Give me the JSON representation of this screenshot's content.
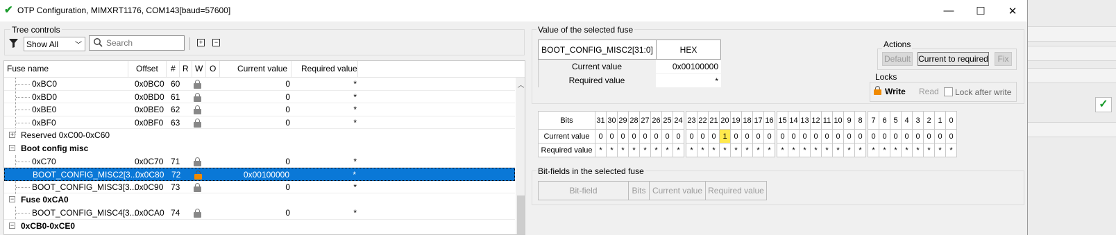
{
  "window": {
    "title": "OTP Configuration, MIMXRT1176, COM143[baud=57600]",
    "minimize": "—",
    "maximize": "☐",
    "close": "✕"
  },
  "tree_controls": {
    "group_label": "Tree controls",
    "filter_value": "Show All",
    "search_placeholder": "Search"
  },
  "tree": {
    "columns": [
      "Fuse name",
      "Offset",
      "#",
      "R",
      "W",
      "O",
      "Current value",
      "Required value"
    ],
    "rows": [
      {
        "kind": "leaf",
        "name": "0xBC0",
        "offset": "0x0BC0",
        "num": "60",
        "current": "0",
        "required": "*"
      },
      {
        "kind": "leaf",
        "name": "0xBD0",
        "offset": "0x0BD0",
        "num": "61",
        "current": "0",
        "required": "*"
      },
      {
        "kind": "leaf",
        "name": "0xBE0",
        "offset": "0x0BE0",
        "num": "62",
        "current": "0",
        "required": "*"
      },
      {
        "kind": "leaf",
        "name": "0xBF0",
        "offset": "0x0BF0",
        "num": "63",
        "current": "0",
        "required": "*"
      },
      {
        "kind": "collapsed",
        "name": "Reserved 0xC00-0xC60"
      },
      {
        "kind": "group",
        "name": "Boot config misc"
      },
      {
        "kind": "leaf",
        "name": "0xC70",
        "offset": "0x0C70",
        "num": "71",
        "current": "0",
        "required": "*"
      },
      {
        "kind": "leaf",
        "name": "BOOT_CONFIG_MISC2[3...",
        "offset": "0x0C80",
        "num": "72",
        "current": "0x00100000",
        "required": "*",
        "selected": true
      },
      {
        "kind": "leaf",
        "name": "BOOT_CONFIG_MISC3[3...",
        "offset": "0x0C90",
        "num": "73",
        "current": "0",
        "required": "*"
      },
      {
        "kind": "group",
        "name": "Fuse 0xCA0"
      },
      {
        "kind": "leaf",
        "name": "BOOT_CONFIG_MISC4[3...",
        "offset": "0x0CA0",
        "num": "74",
        "current": "0",
        "required": "*"
      },
      {
        "kind": "group",
        "name": "0xCB0-0xCE0"
      }
    ]
  },
  "selected_fuse": {
    "group_label": "Value of the selected fuse",
    "name": "BOOT_CONFIG_MISC2[31:0]",
    "format": "HEX",
    "current_label": "Current value",
    "current_value": "0x00100000",
    "required_label": "Required value",
    "required_value": "*"
  },
  "actions": {
    "group_label": "Actions",
    "default_label": "Default",
    "current_to_required_label": "Current to required",
    "fix_label": "Fix"
  },
  "locks": {
    "group_label": "Locks",
    "write_label": "Write",
    "read_label": "Read",
    "lock_after_write_label": "Lock after write"
  },
  "bits": {
    "header_label": "Bits",
    "current_label": "Current value",
    "required_label": "Required value",
    "numbers": [
      "31",
      "30",
      "29",
      "28",
      "27",
      "26",
      "25",
      "24",
      "23",
      "22",
      "21",
      "20",
      "19",
      "18",
      "17",
      "16",
      "15",
      "14",
      "13",
      "12",
      "11",
      "10",
      "9",
      "8",
      "7",
      "6",
      "5",
      "4",
      "3",
      "2",
      "1",
      "0"
    ],
    "current": [
      "0",
      "0",
      "0",
      "0",
      "0",
      "0",
      "0",
      "0",
      "0",
      "0",
      "0",
      "1",
      "0",
      "0",
      "0",
      "0",
      "0",
      "0",
      "0",
      "0",
      "0",
      "0",
      "0",
      "0",
      "0",
      "0",
      "0",
      "0",
      "0",
      "0",
      "0",
      "0"
    ],
    "required": [
      "*",
      "*",
      "*",
      "*",
      "*",
      "*",
      "*",
      "*",
      "*",
      "*",
      "*",
      "*",
      "*",
      "*",
      "*",
      "*",
      "*",
      "*",
      "*",
      "*",
      "*",
      "*",
      "*",
      "*",
      "*",
      "*",
      "*",
      "*",
      "*",
      "*",
      "*",
      "*"
    ],
    "highlight_color": "#ffe94d"
  },
  "bitfields": {
    "group_label": "Bit-fields in the selected fuse",
    "columns": [
      "Bit-field",
      "Bits",
      "Current value",
      "Required value"
    ]
  },
  "colors": {
    "selection": "#0a78d7",
    "lock_write": "#f08a00",
    "check_green": "#1a9b2c"
  }
}
